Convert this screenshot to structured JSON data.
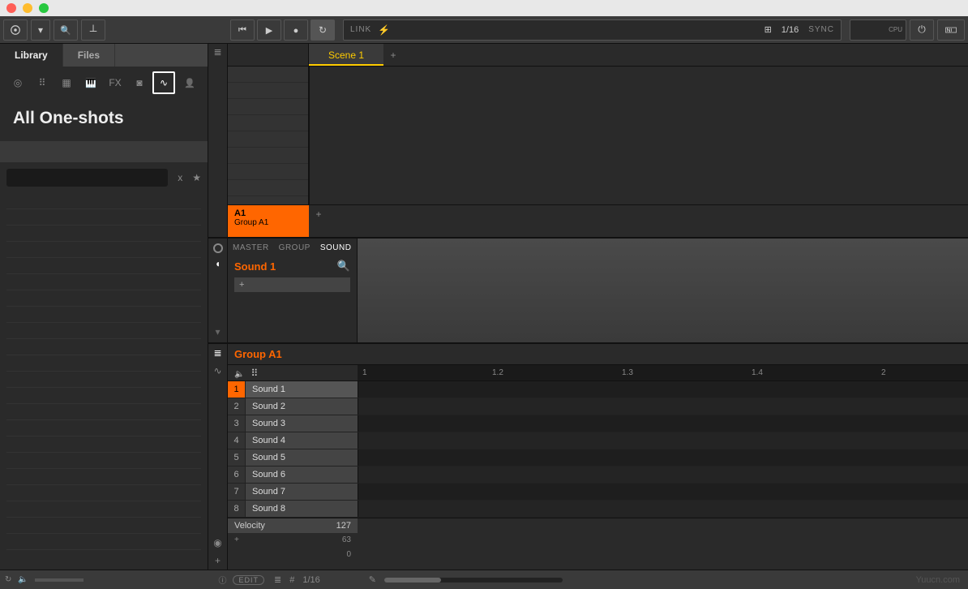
{
  "toolbar": {
    "link_label": "LINK",
    "grid": "1/16",
    "sync_label": "SYNC",
    "cpu_label": "CPU"
  },
  "library": {
    "tabs": {
      "library": "Library",
      "files": "Files"
    },
    "title": "All One-shots",
    "clear": "x",
    "star": "★"
  },
  "arranger": {
    "scene_label": "Scene 1",
    "add": "+",
    "group": {
      "id": "A1",
      "name": "Group A1"
    },
    "group_add": "+"
  },
  "control": {
    "tabs": {
      "master": "MASTER",
      "group": "GROUP",
      "sound": "SOUND"
    },
    "sound_name": "Sound 1",
    "slot_add": "+"
  },
  "pattern_editor": {
    "group_name": "Group A1",
    "timeline": [
      "1",
      "1.2",
      "1.3",
      "1.4",
      "2"
    ],
    "sounds": [
      {
        "num": "1",
        "name": "Sound 1",
        "active": true
      },
      {
        "num": "2",
        "name": "Sound 2",
        "active": false
      },
      {
        "num": "3",
        "name": "Sound 3",
        "active": false
      },
      {
        "num": "4",
        "name": "Sound 4",
        "active": false
      },
      {
        "num": "5",
        "name": "Sound 5",
        "active": false
      },
      {
        "num": "6",
        "name": "Sound 6",
        "active": false
      },
      {
        "num": "7",
        "name": "Sound 7",
        "active": false
      },
      {
        "num": "8",
        "name": "Sound 8",
        "active": false
      }
    ],
    "velocity": {
      "label": "Velocity",
      "max": "127",
      "mid": "63",
      "min": "0",
      "add": "+"
    }
  },
  "footer": {
    "edit": "EDIT",
    "info": "ⓘ",
    "grid": "1/16",
    "pencil": "✎",
    "hash": "#",
    "watermark": "Yuucn.com"
  }
}
